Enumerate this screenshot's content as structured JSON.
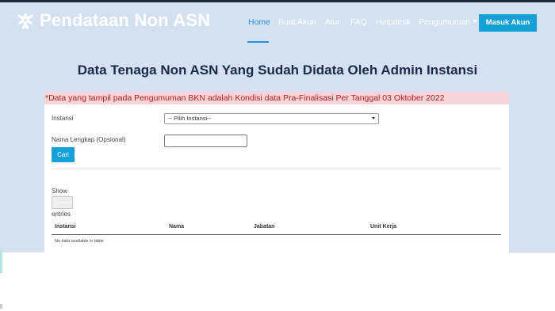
{
  "header": {
    "brand": "Pendataan Non ASN",
    "logo_icon": "garuda-emblem-icon",
    "nav": [
      {
        "label": "Home",
        "active": true
      },
      {
        "label": "Buat Akun"
      },
      {
        "label": "Alur"
      },
      {
        "label": "FAQ"
      },
      {
        "label": "Helpdesk"
      },
      {
        "label": "Pengumuman",
        "dropdown": true
      }
    ],
    "login_button": "Masuk Akun"
  },
  "main": {
    "title": "Data Tenaga Non ASN Yang Sudah Didata Oleh Admin Instansi",
    "notice": "*Data yang tampil pada Pengumuman BKN adalah Kondisi data Pra-Finalisasi Per Tanggal 03 Oktober 2022"
  },
  "form": {
    "instansi_label": "Instansi",
    "instansi_select_value": "-- Pilih Instansi--",
    "nama_label": "Nama Lengkap (Opsional)",
    "nama_value": "",
    "search_button": "Cari"
  },
  "table": {
    "show_label": "Show",
    "entries_label": "entries",
    "columns": [
      "Instansi",
      "Nama",
      "Jabatan",
      "Unit Kerja"
    ],
    "empty_message": "No data available in table"
  },
  "colors": {
    "hero_background": "#d3e1f0",
    "accent": "#15a0d8",
    "notice_background": "#f6d3d6",
    "notice_text": "#b12024",
    "title_text": "#1a2a4a"
  }
}
